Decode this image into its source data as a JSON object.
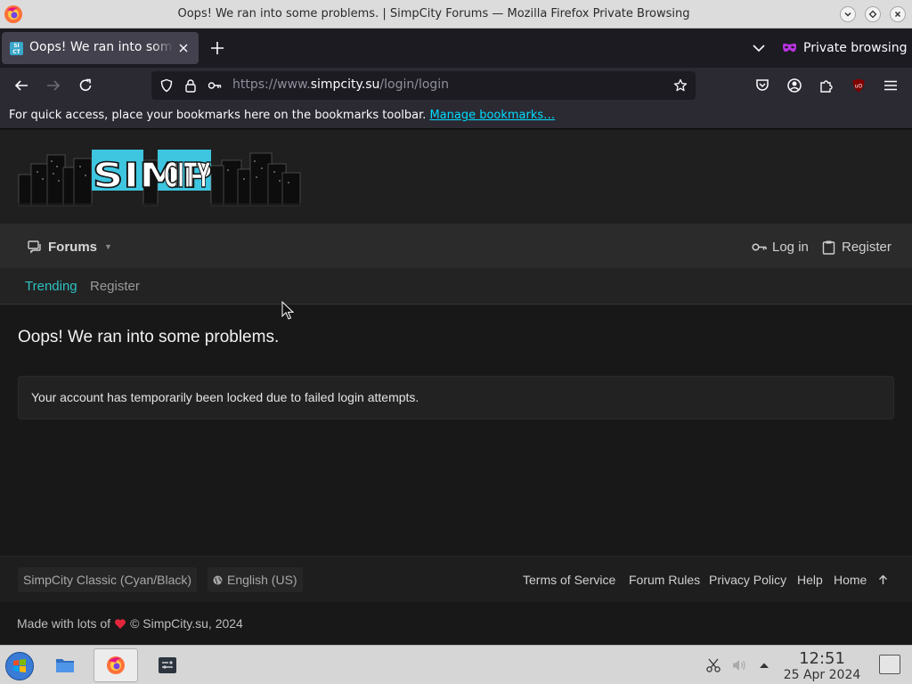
{
  "window": {
    "title": "Oops! We ran into some problems. | SimpCity Forums — Mozilla Firefox Private Browsing",
    "icon": "firefox-icon"
  },
  "tabs": {
    "active_title": "Oops! We ran into some problems.",
    "private_label": "Private browsing"
  },
  "urlbar": {
    "prefix": "https://www.",
    "domain": "simpcity.su",
    "path": "/login/login"
  },
  "bookmarks_bar": {
    "text": "For quick access, place your bookmarks here on the bookmarks toolbar.",
    "link": "Manage bookmarks…"
  },
  "site": {
    "logo_text": "SIMP CITY",
    "nav": {
      "forums": "Forums",
      "login": "Log in",
      "register": "Register"
    },
    "subnav": {
      "trending": "Trending",
      "register": "Register"
    },
    "page_title": "Oops! We ran into some problems.",
    "error_message": "Your account has temporarily been locked due to failed login attempts.",
    "footer": {
      "style_chooser": "SimpCity Classic (Cyan/Black)",
      "language": "English (US)",
      "links": [
        "Terms of Service",
        "Forum Rules",
        "Privacy Policy",
        "Help",
        "Home"
      ],
      "copyright_prefix": "Made with lots of",
      "copyright_suffix": "© SimpCity.su, 2024"
    }
  },
  "taskbar": {
    "time": "12:51",
    "date": "25 Apr 2024"
  },
  "colors": {
    "accent": "#2ec2c2",
    "link": "#00ddff",
    "page_bg": "#181818",
    "heart": "#e0263b"
  }
}
